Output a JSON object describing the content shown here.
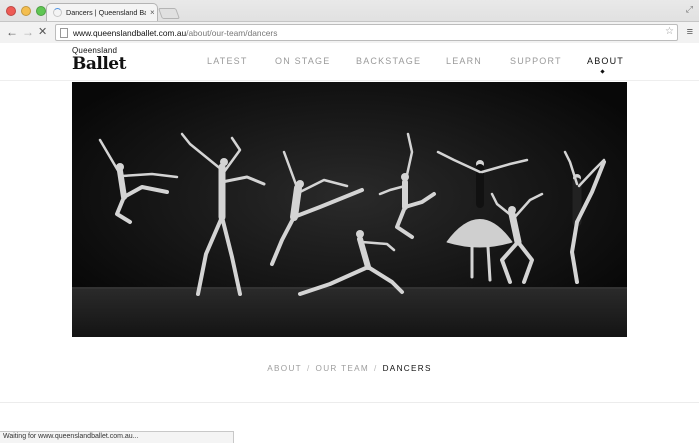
{
  "browser": {
    "tab_title": "Dancers | Queensland Ballet",
    "tab_close": "×",
    "url_host": "www.queenslandballet.com.au",
    "url_path": "/about/our-team/dancers",
    "status_text": "Waiting for www.queenslandballet.com.au..."
  },
  "site": {
    "logo_top": "Queensland",
    "logo_bottom": "Ballet",
    "nav": [
      {
        "label": "LATEST"
      },
      {
        "label": "ON STAGE"
      },
      {
        "label": "BACKSTAGE"
      },
      {
        "label": "LEARN"
      },
      {
        "label": "SUPPORT"
      },
      {
        "label": "ABOUT",
        "active": true
      }
    ]
  },
  "breadcrumb": {
    "items": [
      "ABOUT",
      "OUR TEAM",
      "DANCERS"
    ],
    "separator": "/"
  },
  "icons": {
    "back": "arrow-left",
    "forward": "arrow-right",
    "stop": "close",
    "star": "star",
    "menu": "hamburger",
    "fullscreen": "expand-arrows"
  },
  "colors": {
    "accent": "#111111",
    "nav_inactive": "#9a9a9a",
    "hero_bg": "#0c0c0c"
  }
}
